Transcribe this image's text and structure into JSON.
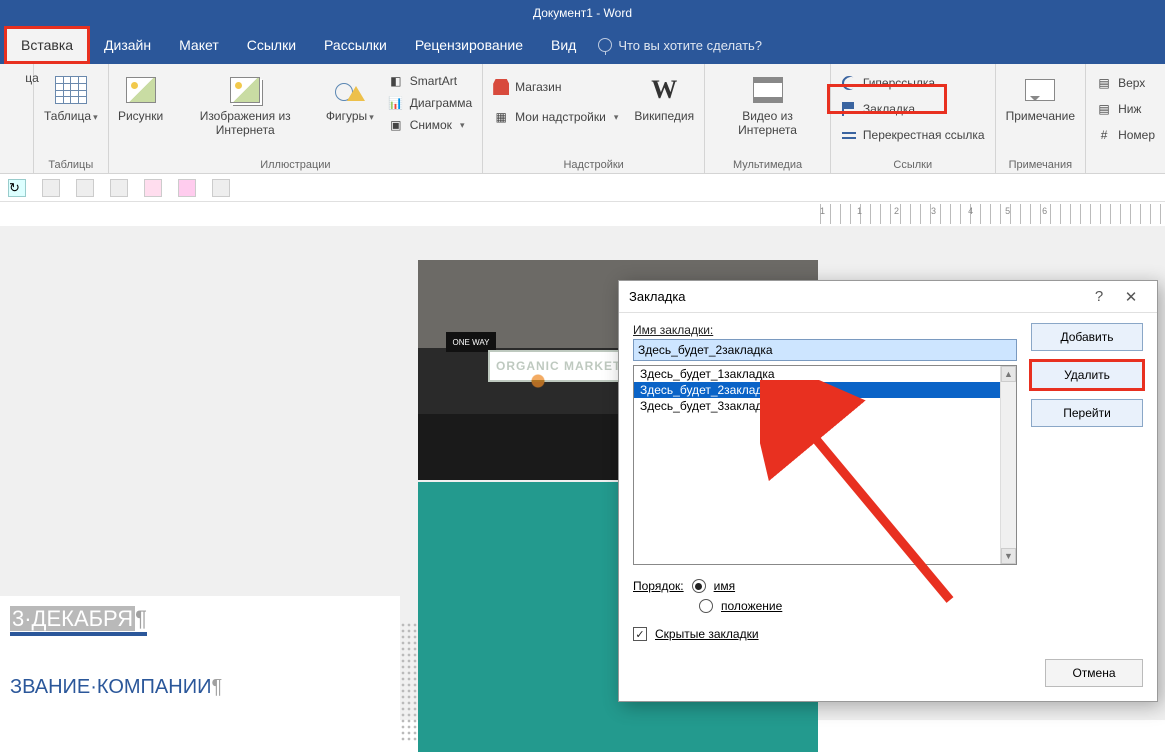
{
  "title": "Документ1 - Word",
  "tabs": {
    "insert": "Вставка",
    "design": "Дизайн",
    "layout": "Макет",
    "references": "Ссылки",
    "mailings": "Рассылки",
    "review": "Рецензирование",
    "view": "Вид"
  },
  "tellme": "Что вы хотите сделать?",
  "ribbon": {
    "partial_left": "ца",
    "tables": {
      "table": "Таблица",
      "group": "Таблицы"
    },
    "illus": {
      "pictures": "Рисунки",
      "online_pics": "Изображения из Интернета",
      "shapes": "Фигуры",
      "smartart": "SmartArt",
      "chart": "Диаграмма",
      "screenshot": "Снимок",
      "group": "Иллюстрации"
    },
    "addins": {
      "store": "Магазин",
      "myaddins": "Мои надстройки",
      "wikipedia": "Википедия",
      "group": "Надстройки"
    },
    "media": {
      "video": "Видео из Интернета",
      "group": "Мультимедиа"
    },
    "links": {
      "hyperlink": "Гиперссылка",
      "bookmark": "Закладка",
      "crossref": "Перекрестная ссылка",
      "group": "Ссылки"
    },
    "comments": {
      "comment": "Примечание",
      "group": "Примечания"
    },
    "header": {
      "top": "Верх",
      "bottom": "Ниж",
      "number": "Номер"
    }
  },
  "ruler_nums": [
    "1",
    "·",
    "1",
    "·",
    "2",
    "·",
    "3",
    "·",
    "4",
    "·",
    "5",
    "·",
    "6"
  ],
  "doc": {
    "date": "3·ДЕКАБРЯ",
    "company": "ЗВАНИЕ·КОМПАНИИ",
    "photo_sign": "ORGANIC MARKET",
    "oneway": "ONE WAY"
  },
  "dialog": {
    "title": "Закладка",
    "name_label": "Имя закладки:",
    "name_value": "Здесь_будет_2закладка",
    "items": [
      "Здесь_будет_1закладка",
      "Здесь_будет_2закладка",
      "Здесь_будет_3закладка"
    ],
    "selected_index": 1,
    "add": "Добавить",
    "delete": "Удалить",
    "goto": "Перейти",
    "sort_label": "Порядок:",
    "sort_name": "имя",
    "sort_loc": "положение",
    "hidden": "Скрытые закладки",
    "cancel": "Отмена",
    "help": "?",
    "close": "✕"
  }
}
